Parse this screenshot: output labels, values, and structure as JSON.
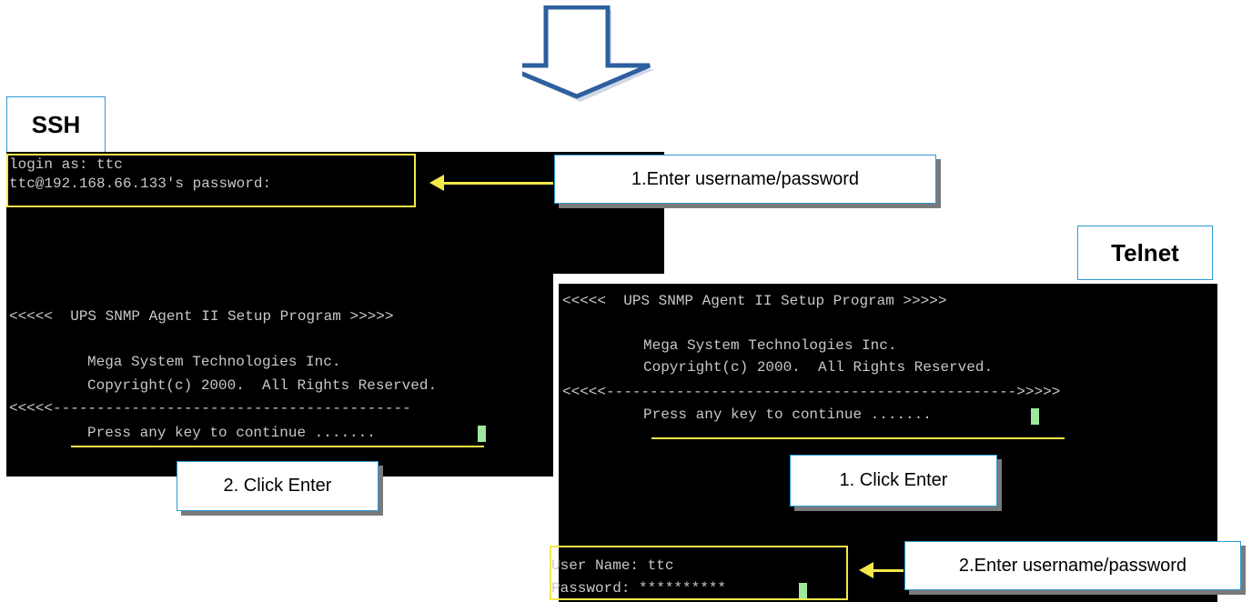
{
  "colors": {
    "terminal_bg": "#000000",
    "terminal_text": "#c8c8c8",
    "cursor": "#9ee89e",
    "highlight": "#f5e84a",
    "box_border": "#2f9bd6",
    "flow_arrow": "#2e5f9e"
  },
  "ssh": {
    "title": "SSH",
    "line_login": "login as: ttc",
    "line_password": "ttc@192.168.66.133's password:",
    "banner": "<<<<<  UPS SNMP Agent II Setup Program >>>>>",
    "company": "Mega System Technologies Inc.",
    "copyright": "Copyright(c) 2000.  All Rights Reserved.",
    "separator": "<<<<<-----------------------------------------",
    "press_key": "Press any key to continue .......",
    "step1": "1.Enter username/password",
    "step2": "2. Click Enter"
  },
  "telnet": {
    "title": "Telnet",
    "banner": "<<<<<  UPS SNMP Agent II Setup Program >>>>>",
    "company": "Mega System Technologies Inc.",
    "copyright": "Copyright(c) 2000.  All Rights Reserved.",
    "separator": "<<<<<----------------------------------------------->>>>>",
    "press_key": "Press any key to continue .......",
    "user_name": "User Name: ttc",
    "password": "Password: **********",
    "step1": "1. Click Enter",
    "step2": "2.Enter username/password"
  }
}
